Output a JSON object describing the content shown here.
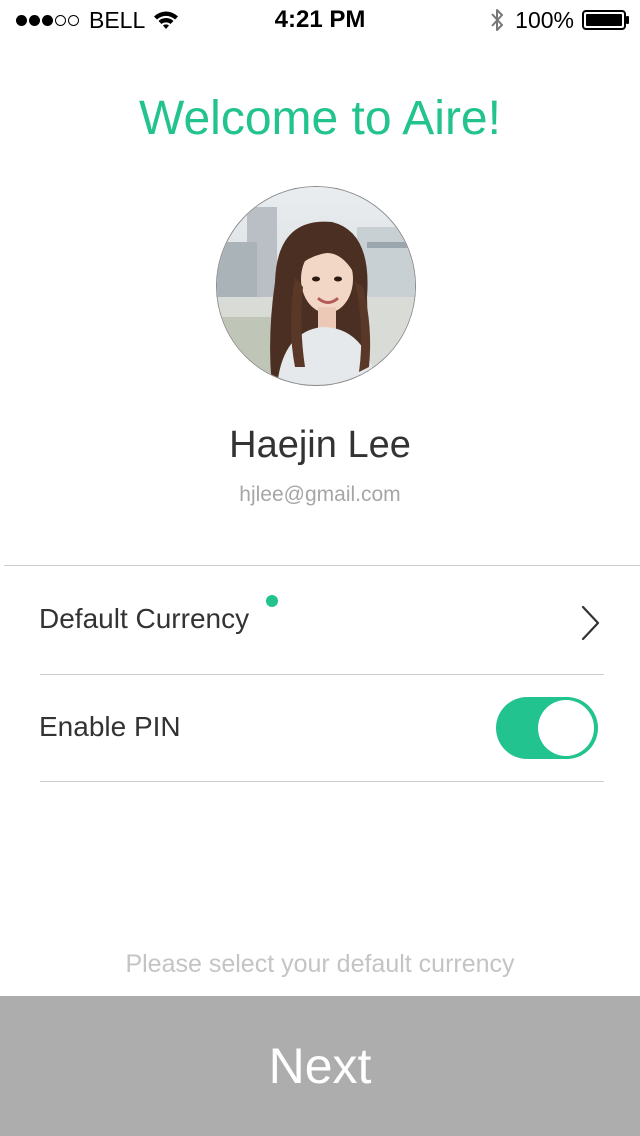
{
  "status_bar": {
    "signal_bars_filled": 3,
    "signal_bars_total": 5,
    "carrier": "BELL",
    "time": "4:21 PM",
    "battery_percent": "100%",
    "icons": [
      "wifi-icon",
      "bluetooth-icon",
      "battery-icon"
    ]
  },
  "welcome_title": "Welcome to Aire!",
  "profile": {
    "name": "Haejin Lee",
    "email": "hjlee@gmail.com",
    "avatar_icon": "profile-photo"
  },
  "settings": {
    "default_currency": {
      "label": "Default Currency",
      "has_indicator": true,
      "icon": "chevron-right-icon"
    },
    "enable_pin": {
      "label": "Enable PIN",
      "enabled": true
    }
  },
  "hint": "Please select your default currency",
  "next_button": "Next",
  "colors": {
    "accent": "#22c38e",
    "button_bg": "#adadad",
    "hint_text": "#c4c4c4",
    "email_text": "#a6a6a6",
    "divider": "#cfcfcf"
  }
}
